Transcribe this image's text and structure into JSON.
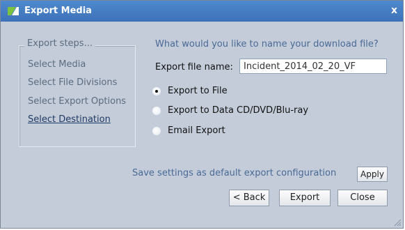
{
  "window": {
    "title": "Export Media",
    "close_label": "x"
  },
  "steps": {
    "legend": "Export steps...",
    "items": [
      {
        "label": "Select Media"
      },
      {
        "label": "Select File Divisions"
      },
      {
        "label": "Select Export Options"
      },
      {
        "label": "Select Destination",
        "active": true
      }
    ]
  },
  "form": {
    "question": "What would you like to name your download file?",
    "filename_label": "Export file name:",
    "filename_value": "Incident_2014_02_20_VF",
    "options": [
      {
        "label": "Export to File",
        "checked": true
      },
      {
        "label": "Export to Data CD/DVD/Blu-ray",
        "checked": false
      },
      {
        "label": "Email Export",
        "checked": false
      }
    ]
  },
  "footer": {
    "save_text": "Save settings as default export configuration",
    "apply_label": "Apply",
    "back_label": "< Back",
    "export_label": "Export",
    "close_label": "Close"
  },
  "colors": {
    "titlebar": "#3d72b8",
    "dialog_bg": "#c3ccd8",
    "link_text": "#4a6a95"
  },
  "icons": [
    "app-logo-icon",
    "close-icon",
    "resize-grip-icon"
  ]
}
